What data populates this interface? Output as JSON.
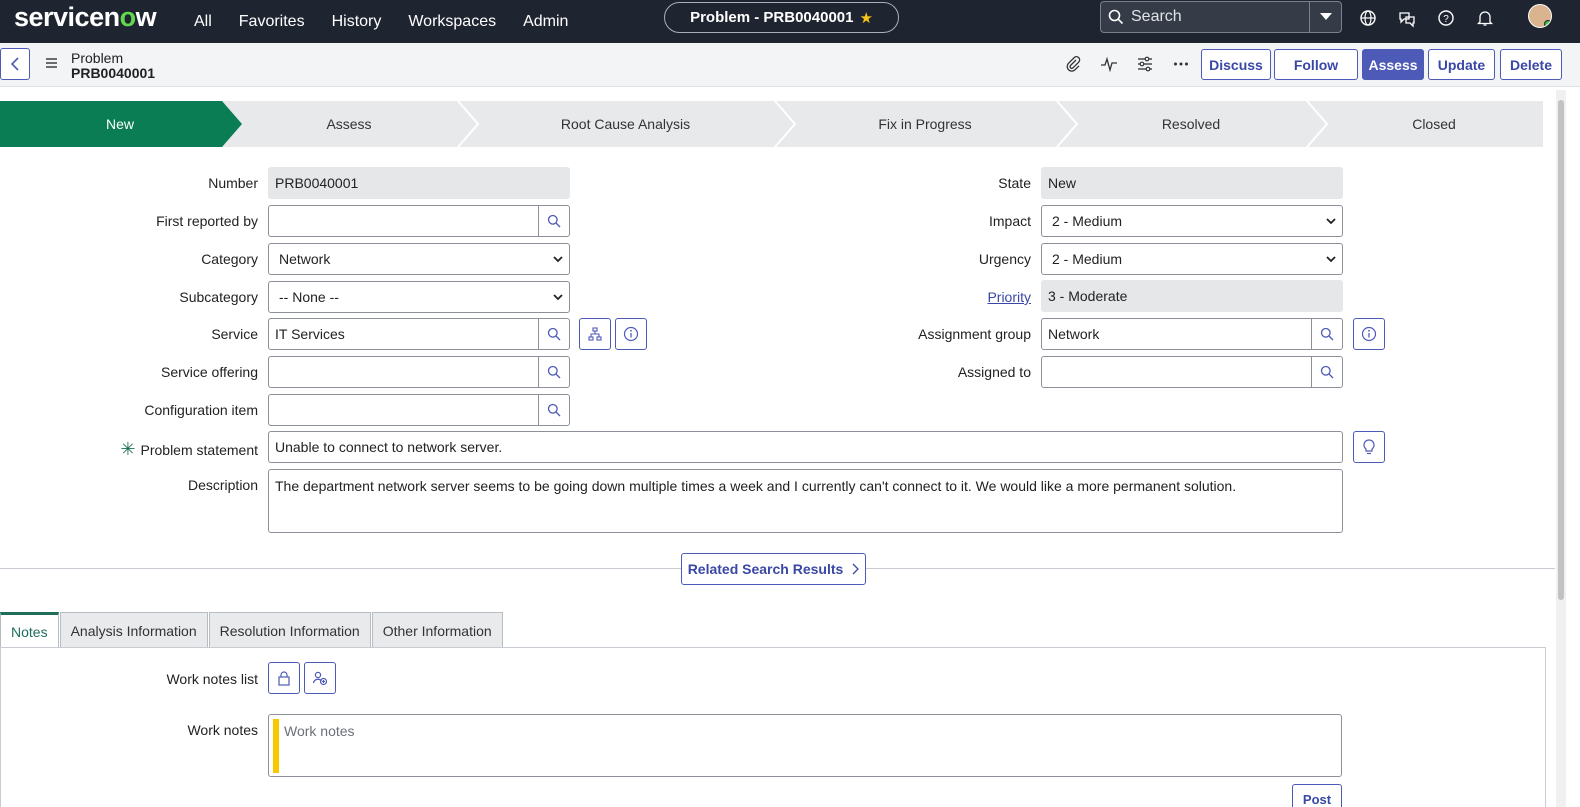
{
  "brand": {
    "logo_text_pre": "servicen",
    "logo_o": "o",
    "logo_text_post": "w"
  },
  "nav": {
    "items": [
      "All",
      "Favorites",
      "History",
      "Workspaces",
      "Admin"
    ]
  },
  "title_pill": {
    "text": "Problem - PRB0040001"
  },
  "search": {
    "placeholder": "Search"
  },
  "header": {
    "record_type": "Problem",
    "record_number": "PRB0040001",
    "buttons": {
      "discuss": "Discuss",
      "follow": "Follow",
      "assess": "Assess",
      "update": "Update",
      "delete": "Delete"
    }
  },
  "process_flow": {
    "steps": [
      "New",
      "Assess",
      "Root Cause Analysis",
      "Fix in Progress",
      "Resolved",
      "Closed"
    ],
    "active_index": 0,
    "active_color": "#0b7d55"
  },
  "form": {
    "number": {
      "label": "Number",
      "value": "PRB0040001"
    },
    "first_reported_by": {
      "label": "First reported by",
      "value": ""
    },
    "category": {
      "label": "Category",
      "value": "Network"
    },
    "subcategory": {
      "label": "Subcategory",
      "value": "-- None --"
    },
    "service": {
      "label": "Service",
      "value": "IT Services"
    },
    "service_offering": {
      "label": "Service offering",
      "value": ""
    },
    "configuration_item": {
      "label": "Configuration item",
      "value": ""
    },
    "state": {
      "label": "State",
      "value": "New"
    },
    "impact": {
      "label": "Impact",
      "value": "2 - Medium"
    },
    "urgency": {
      "label": "Urgency",
      "value": "2 - Medium"
    },
    "priority": {
      "label": "Priority",
      "value": "3 - Moderate"
    },
    "assignment_group": {
      "label": "Assignment group",
      "value": "Network"
    },
    "assigned_to": {
      "label": "Assigned to",
      "value": ""
    },
    "problem_statement": {
      "label": "Problem statement",
      "value": "Unable to connect to network server."
    },
    "description": {
      "label": "Description",
      "value": "The department network server seems to be going down multiple times a week and I currently can't connect to it. We would like a more permanent solution."
    }
  },
  "related_search": {
    "label": "Related Search Results"
  },
  "tabs": [
    "Notes",
    "Analysis Information",
    "Resolution Information",
    "Other Information"
  ],
  "notes": {
    "work_notes_list_label": "Work notes list",
    "work_notes_label": "Work notes",
    "work_notes_placeholder": "Work notes",
    "post_label": "Post"
  },
  "colors": {
    "nav_bg": "#1e2430",
    "primary": "#4e5ab8",
    "work_notes_bar": "#f5c800"
  }
}
